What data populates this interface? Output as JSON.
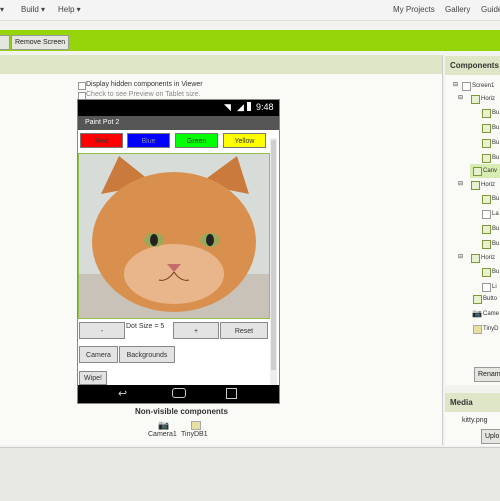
{
  "menu": {
    "build": "Build",
    "help": "Help",
    "my_projects": "My Projects",
    "gallery": "Gallery",
    "guide": "Guide"
  },
  "toolbar": {
    "remove_screen": "Remove Screen"
  },
  "viewer": {
    "display_hidden": "Display hidden components in Viewer",
    "tablet_preview": "Check to see Preview on Tablet size."
  },
  "phone": {
    "time": "9:48",
    "app_title": "Paint Pot 2",
    "color_buttons": [
      {
        "label": "Red",
        "color": "#ff0000"
      },
      {
        "label": "Blue",
        "color": "#0000ff"
      },
      {
        "label": "Green",
        "color": "#00ff00"
      },
      {
        "label": "Yellow",
        "color": "#ffff00"
      }
    ],
    "minus_label": "-",
    "dot_size_label": "Dot Size = 5",
    "plus_label": "+",
    "reset_label": "Reset",
    "camera_label": "Camera",
    "backgrounds_label": "Backgrounds",
    "wipe_label": "Wipe!"
  },
  "nonvisible": {
    "heading": "Non-visible components",
    "items": [
      "Camera1",
      "TinyDB1"
    ]
  },
  "components": {
    "heading": "Components",
    "tree": [
      "Screen1",
      "Horiz",
      "Bu",
      "Bu",
      "Bu",
      "Bu",
      "Canv",
      "Horiz",
      "Bu",
      "La",
      "Bu",
      "Bu",
      "Horiz",
      "Bu",
      "Li",
      "Butto",
      "Came",
      "TinyD"
    ],
    "rename_label": "Renam"
  },
  "media": {
    "heading": "Media",
    "file": "kitty.png",
    "upload_label": "Uplo"
  },
  "colors": {
    "accent": "#96d40a",
    "panel_header": "#dfe6c8"
  }
}
